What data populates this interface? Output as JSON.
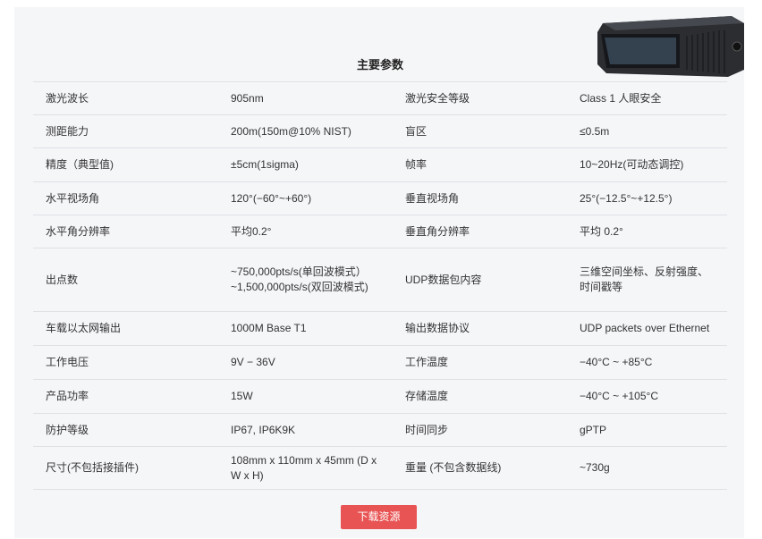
{
  "section_title": "主要参数",
  "download_button": "下载资源",
  "product_image_icon": "lidar-device-image",
  "colors": {
    "accent": "#e85454",
    "panel_bg": "#f5f6f8",
    "border": "#dfe1e5"
  },
  "specs": [
    [
      "激光波长",
      "905nm",
      "激光安全等级",
      "Class 1 人眼安全"
    ],
    [
      "测距能力",
      "200m(150m@10% NIST)",
      "盲区",
      "≤0.5m"
    ],
    [
      "精度（典型值)",
      "±5cm(1sigma)",
      "帧率",
      "10~20Hz(可动态调控)"
    ],
    [
      "水平视场角",
      "120°(−60°~+60°)",
      "垂直视场角",
      "25°(−12.5°~+12.5°)"
    ],
    [
      "水平角分辨率",
      "平均0.2°",
      "垂直角分辨率",
      "平均 0.2°"
    ],
    [
      "出点数",
      "~750,000pts/s(单回波模式）~1,500,000pts/s(双回波模式)",
      "UDP数据包内容",
      "三维空间坐标、反射强度、时间戳等"
    ],
    [
      "车载以太网输出",
      "1000M Base T1",
      "输出数据协议",
      "UDP packets over Ethernet"
    ],
    [
      "工作电压",
      "9V − 36V",
      "工作温度",
      "−40°C ~ +85°C"
    ],
    [
      "产品功率",
      "15W",
      "存储温度",
      "−40°C ~ +105°C"
    ],
    [
      "防护等级",
      "IP67, IP6K9K",
      "时间同步",
      "gPTP"
    ],
    [
      "尺寸(不包括接插件)",
      "108mm x 110mm x 45mm (D x W x H)",
      "重量 (不包含数据线)",
      "~730g"
    ]
  ]
}
